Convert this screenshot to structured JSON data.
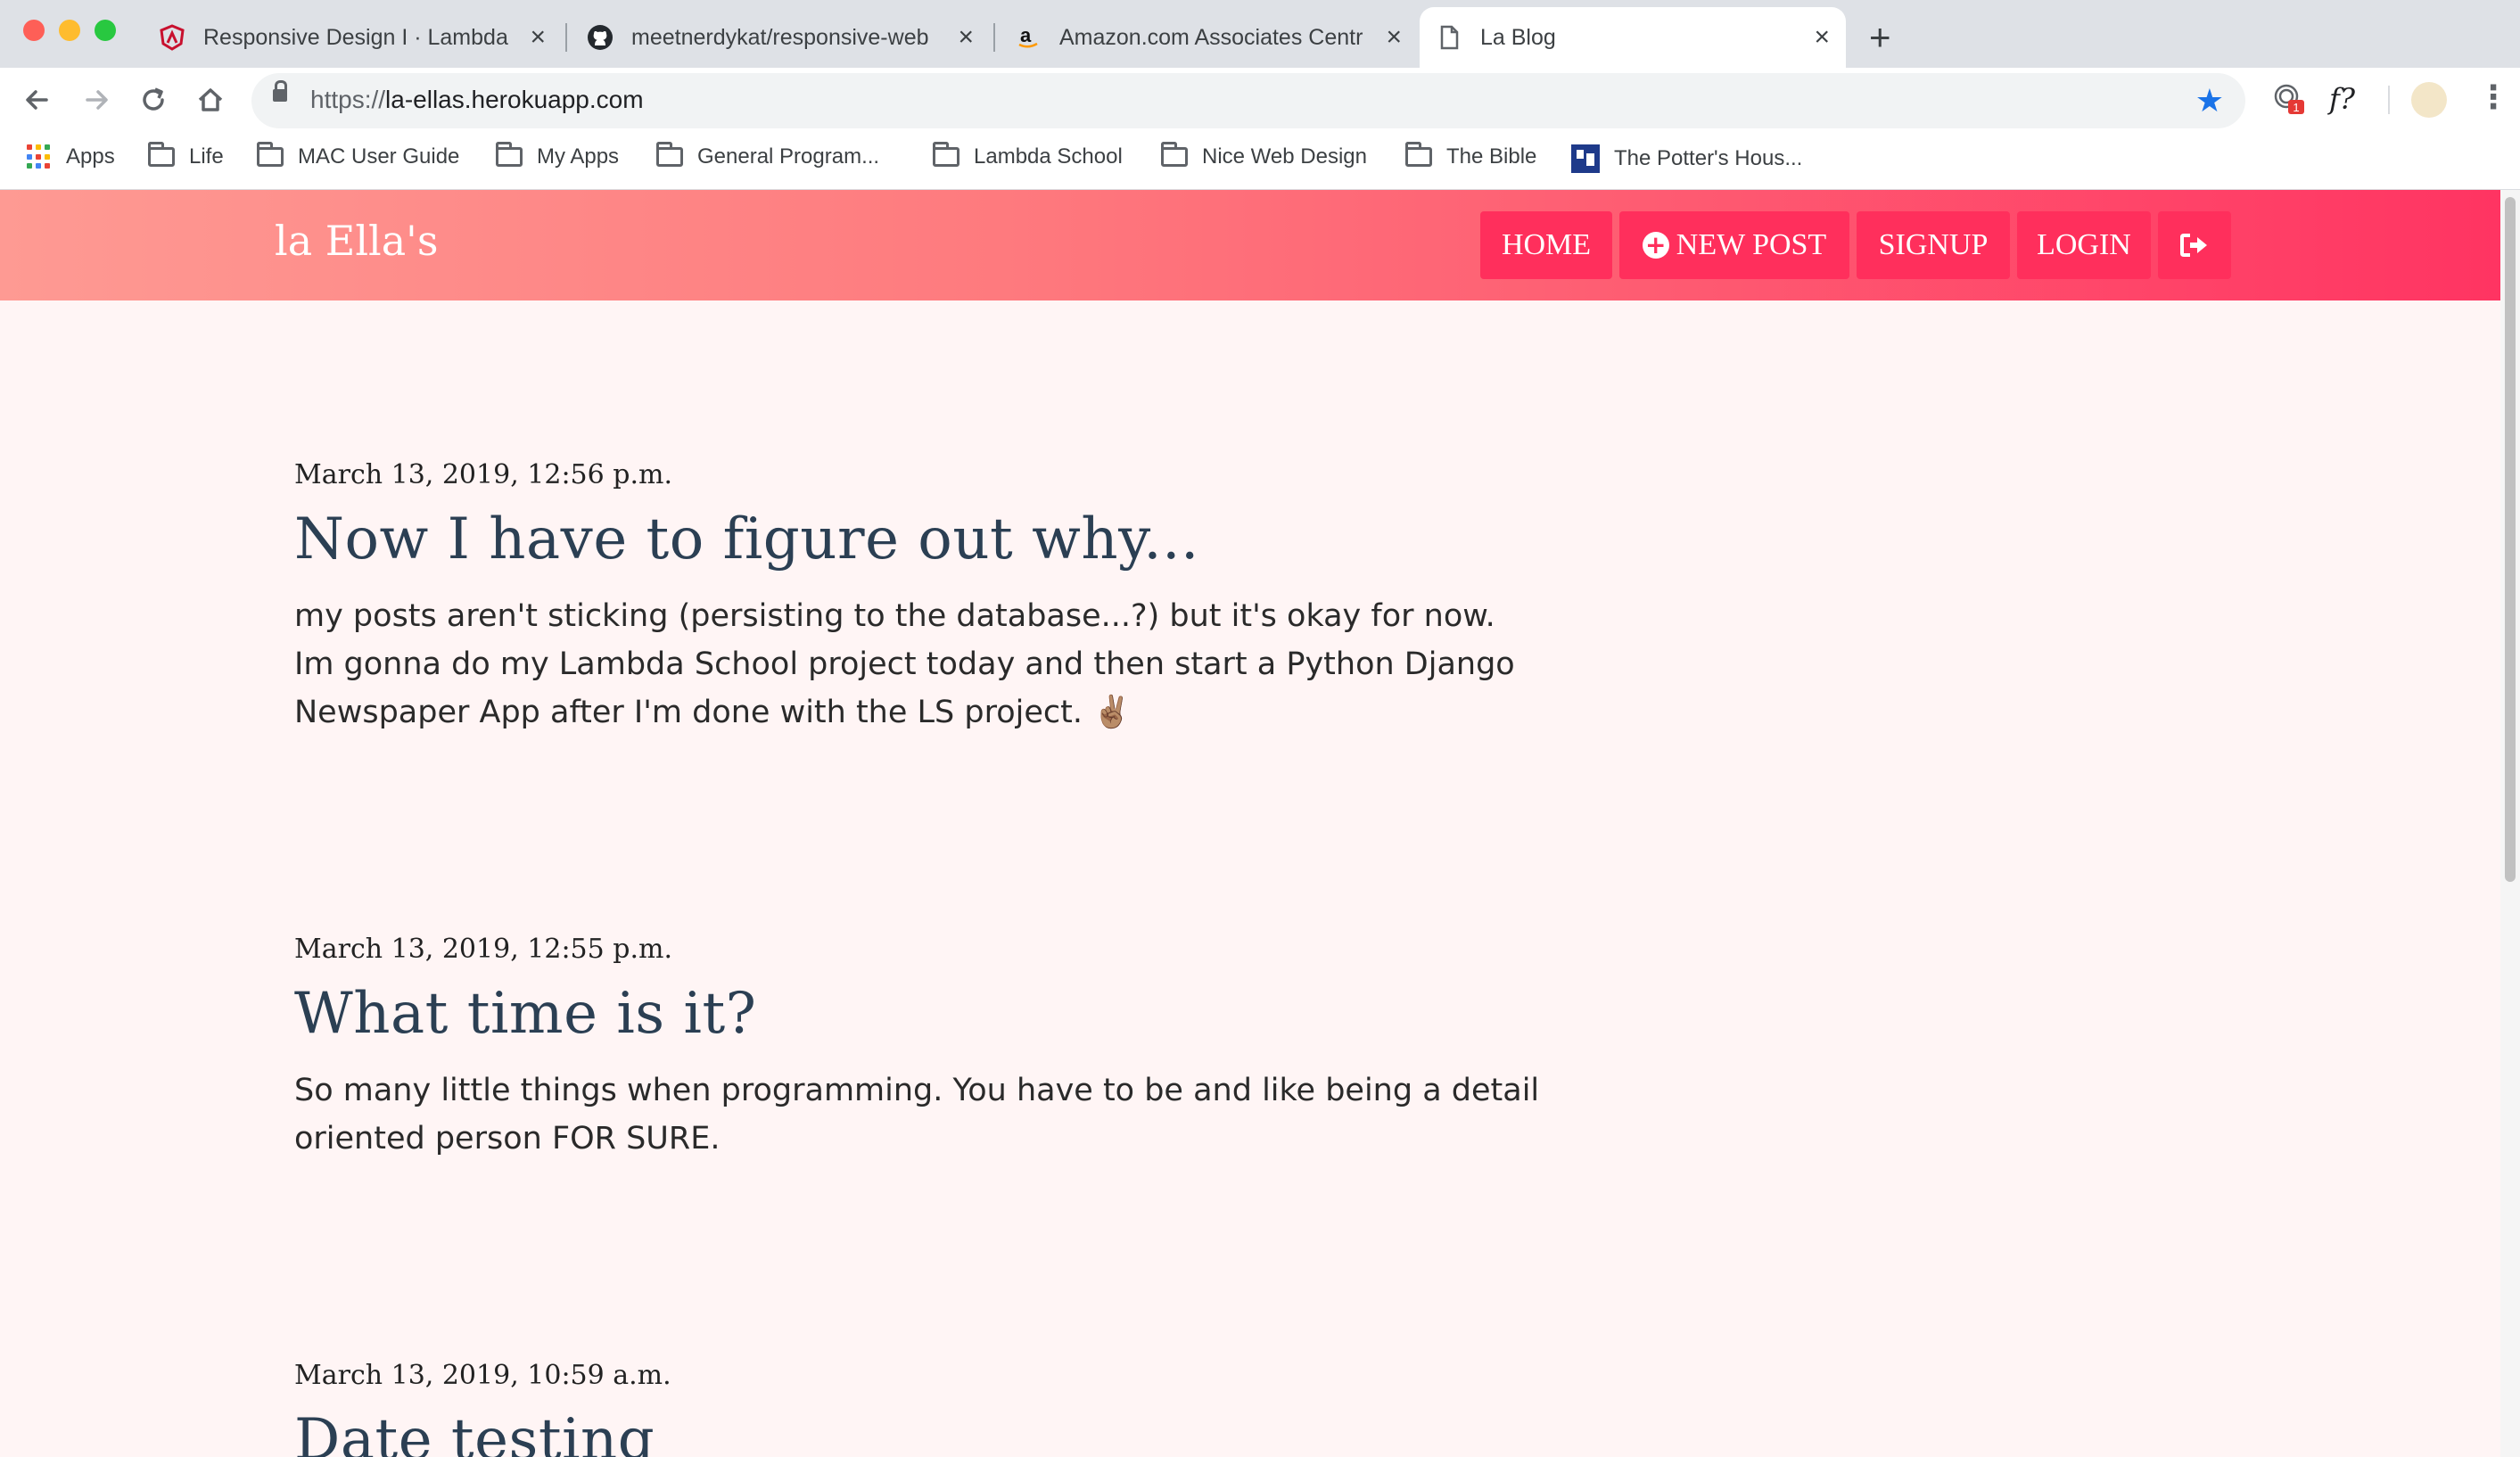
{
  "browser": {
    "tabs": [
      {
        "title": "Responsive Design I · Lambda",
        "close": "×",
        "icon": "lambda-icon"
      },
      {
        "title": "meetnerdykat/responsive-web",
        "close": "×",
        "icon": "github-icon"
      },
      {
        "title": "Amazon.com Associates Centr",
        "close": "×",
        "icon": "amazon-icon"
      },
      {
        "title": "La Blog",
        "close": "×",
        "icon": "document-icon",
        "active": true
      }
    ],
    "new_tab": "+",
    "url_scheme": "https://",
    "url_host": "la-ellas.herokuapp.com",
    "extension_badge": "1",
    "extension_label": "f?",
    "bookmarks": [
      {
        "label": "Apps",
        "icon": "apps-grid-icon"
      },
      {
        "label": "Life",
        "icon": "folder-icon"
      },
      {
        "label": "MAC User Guide",
        "icon": "folder-icon"
      },
      {
        "label": "My Apps",
        "icon": "folder-icon"
      },
      {
        "label": "General Program...",
        "icon": "folder-icon"
      },
      {
        "label": "Lambda School",
        "icon": "folder-icon"
      },
      {
        "label": "Nice Web Design",
        "icon": "folder-icon"
      },
      {
        "label": "The Bible",
        "icon": "folder-icon"
      },
      {
        "label": "The Potter's Hous...",
        "icon": "potters-house-icon"
      }
    ]
  },
  "site": {
    "brand": "la Ella's",
    "nav": {
      "home": "HOME",
      "new_post": "NEW POST",
      "signup": "SIGNUP",
      "login": "LOGIN"
    },
    "colors": {
      "header_start": "#fe9a93",
      "header_end": "#ff3462",
      "button": "#ff2f5c"
    }
  },
  "posts": [
    {
      "date": "March 13, 2019, 12:56 p.m.",
      "title": "Now I have to figure out why...",
      "body": "my posts aren't sticking (persisting to the database...?) but it's okay for now. Im gonna do my Lambda School project today and then start a Python Django Newspaper App after I'm done with the LS project. ✌🏽"
    },
    {
      "date": "March 13, 2019, 12:55 p.m.",
      "title": "What time is it?",
      "body": "So many little things when programming. You have to be and like being a detail oriented person FOR SURE."
    },
    {
      "date": "March 13, 2019, 10:59 a.m.",
      "title": "Date testing"
    }
  ]
}
